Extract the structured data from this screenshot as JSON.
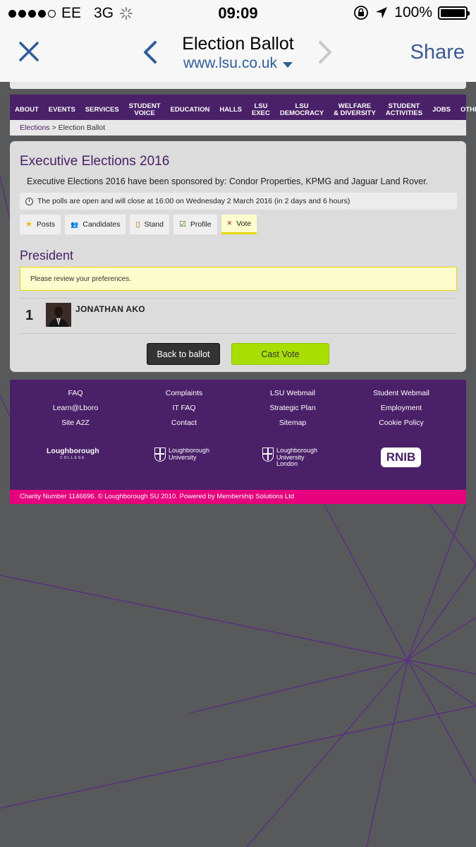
{
  "status_bar": {
    "carrier": "EE",
    "network": "3G",
    "time": "09:09",
    "battery": "100%",
    "signal_bars": 4,
    "signal_total": 5
  },
  "browser": {
    "title": "Election Ballot",
    "url": "www.lsu.co.uk",
    "share_label": "Share"
  },
  "nav": {
    "items": [
      "ABOUT",
      "EVENTS",
      "SERVICES",
      "STUDENT\nVOICE",
      "EDUCATION",
      "HALLS",
      "LSU\nEXEC",
      "LSU\nDEMOCRACY",
      "WELFARE\n& DIVERSITY",
      "STUDENT\nACTIVITIES",
      "JOBS",
      "OTHER"
    ]
  },
  "breadcrumb": {
    "link": "Elections",
    "separator": ">",
    "current": "Election Ballot"
  },
  "election": {
    "title": "Executive Elections 2016",
    "sponsor_text": "Executive Elections 2016 have been sponsored by: Condor Properties, KPMG and Jaguar Land Rover.",
    "polls_text": "The polls are open and will close at 16:00 on Wednesday 2 March 2016 (in 2 days and 6 hours)",
    "tabs": [
      {
        "label": "Posts",
        "icon": "star-icon"
      },
      {
        "label": "Candidates",
        "icon": "people-icon"
      },
      {
        "label": "Stand",
        "icon": "clipboard-icon"
      },
      {
        "label": "Profile",
        "icon": "checkbox-icon"
      },
      {
        "label": "Vote",
        "icon": "ballot-icon",
        "active": true
      }
    ]
  },
  "ballot": {
    "post": "President",
    "notice": "Please review your preferences.",
    "preference_number": "1",
    "candidate_name": "JONATHAN AKO",
    "back_button": "Back to ballot",
    "cast_button": "Cast Vote"
  },
  "footer": {
    "columns": [
      [
        "FAQ",
        "Learn@Lboro",
        "Site A2Z"
      ],
      [
        "Complaints",
        "IT FAQ",
        "Contact"
      ],
      [
        "LSU Webmail",
        "Strategic Plan",
        "Sitemap"
      ],
      [
        "Student Webmail",
        "Employment",
        "Cookie Policy"
      ]
    ],
    "logos": {
      "lc": "Loughborough",
      "lc_sub": "COLLEGE",
      "lu_1": "Loughborough",
      "lu_2": "University",
      "lul_1": "Loughborough",
      "lul_2": "University",
      "lul_3": "London",
      "rnib": "RNIB"
    },
    "charity": "Charity Number 1146696. © Loughborough SU 2010. Powered by Membership Solutions Ltd"
  },
  "colors": {
    "brand_purple": "#4a2068",
    "accent_pink": "#e6007e",
    "cast_green": "#a8df00",
    "ios_blue": "#2e5d9a"
  }
}
